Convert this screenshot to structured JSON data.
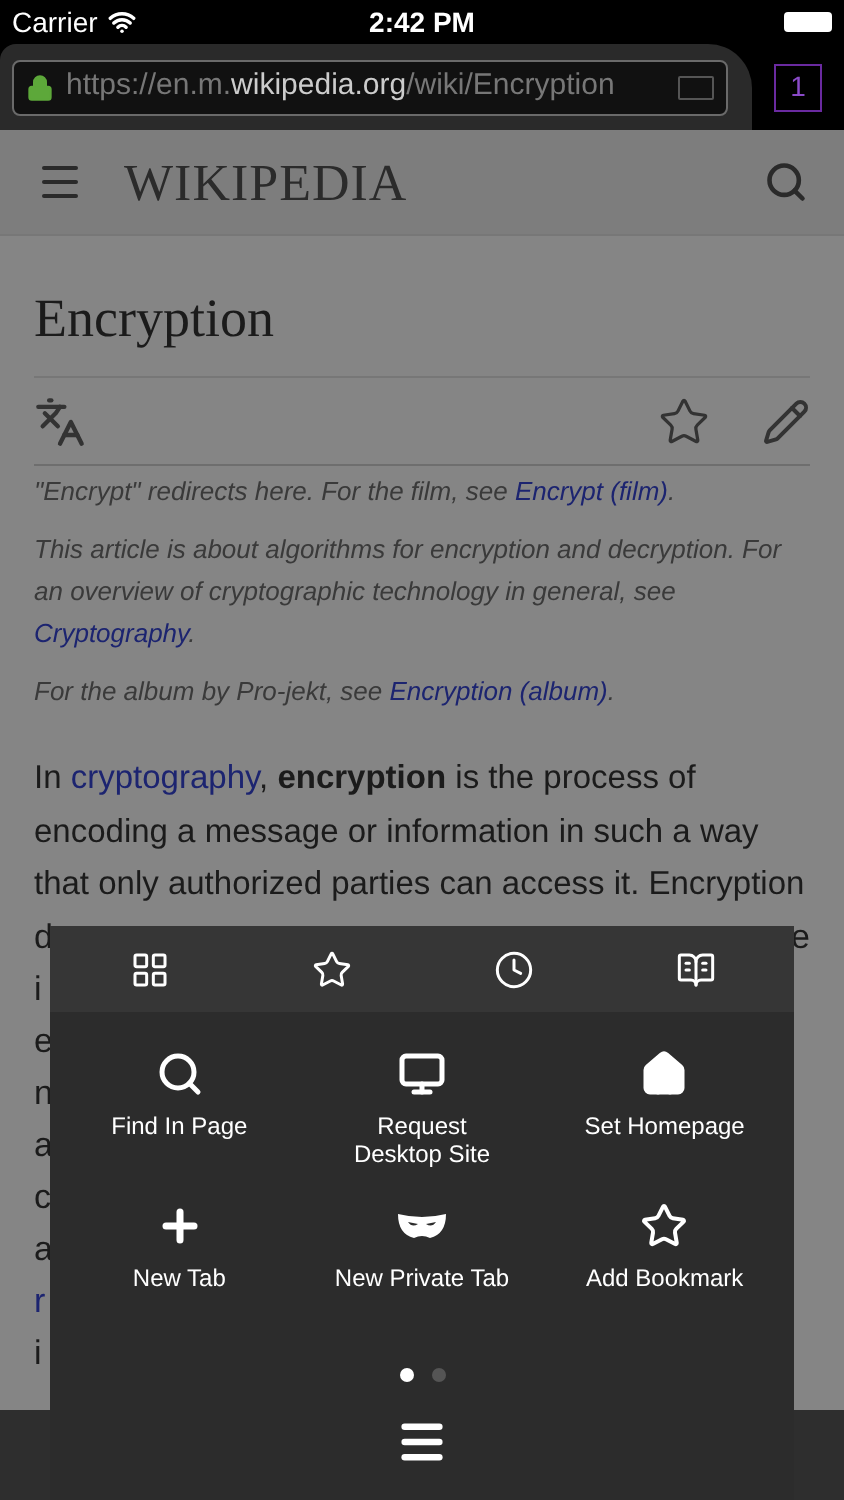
{
  "status_bar": {
    "carrier": "Carrier",
    "time": "2:42 PM"
  },
  "address_bar": {
    "url_scheme": "https://en.m.",
    "url_host": "wikipedia.org",
    "url_path": "/wiki/Encryption",
    "secure": true
  },
  "tab_count": "1",
  "site_header": {
    "logo": "WIKIPEDIA"
  },
  "article": {
    "title": "Encryption",
    "hatnotes": [
      {
        "text": "\"Encrypt\" redirects here. For the film, see",
        "link": "Encrypt (film)",
        "after": "."
      },
      {
        "text": "This article is about algorithms for encryption and decryption. For an overview of cryptographic technology in general, see",
        "link": "Cryptography",
        "after": "."
      },
      {
        "text": "For the album by Pro-jekt, see",
        "link": "Encryption (album)",
        "after": "."
      }
    ],
    "lead": [
      "In ",
      "cryptography",
      ", **encryption** is the process of encoding a message or information in such a way that only authorized parties can access it. Encryption"
    ],
    "covered_lines": [
      {
        "start": "d",
        "end": "e",
        "link": false
      },
      {
        "start": "i",
        "link": false
      },
      {
        "start": "e",
        "link": false
      },
      {
        "start": "n",
        "link": false
      },
      {
        "start": "a",
        "link": false
      },
      {
        "start": "c",
        "link": false
      },
      {
        "start": "a",
        "link": false
      },
      {
        "start": "r",
        "link": true
      },
      {
        "start": "i",
        "link": false
      }
    ]
  },
  "menu": {
    "tabs": [
      {
        "kind": "tabs",
        "selected": false
      },
      {
        "kind": "bookmarks",
        "selected": false
      },
      {
        "kind": "history",
        "selected": false
      },
      {
        "kind": "reading_list",
        "selected": false
      }
    ],
    "actions": [
      {
        "kind": "find",
        "label": "Find In Page"
      },
      {
        "kind": "desktop",
        "label": "Request\nDesktop Site"
      },
      {
        "kind": "home",
        "label": "Set Homepage"
      },
      {
        "kind": "new_tab",
        "label": "New Tab"
      },
      {
        "kind": "private",
        "label": "New Private Tab"
      },
      {
        "kind": "bookmark",
        "label": "Add Bookmark"
      }
    ],
    "pages": [
      {
        "selected": true
      },
      {
        "selected": false
      }
    ]
  }
}
